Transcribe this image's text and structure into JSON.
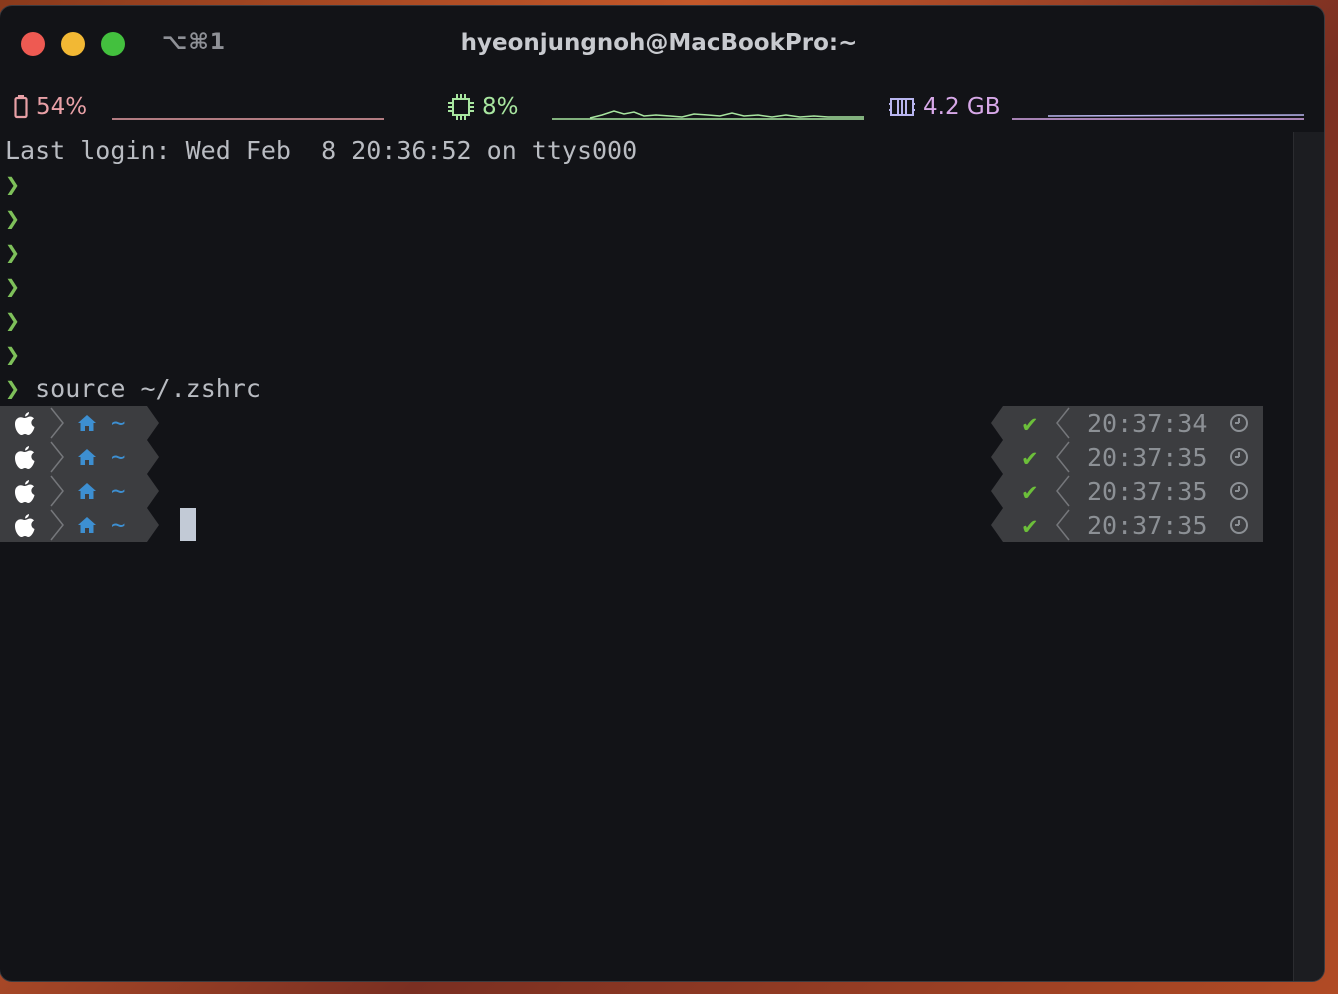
{
  "window": {
    "title": "hyeonjungnoh@MacBookPro:~",
    "shortcut": "⌥⌘1"
  },
  "status_bar": {
    "battery": "54%",
    "cpu": "8%",
    "memory": "4.2 GB"
  },
  "terminal": {
    "last_login": "Last login: Wed Feb  8 20:36:52 on ttys000",
    "prompt_char": "❯",
    "command": "source ~/.zshrc",
    "empty_prompts": 6,
    "rich_prompts": [
      {
        "path": "~",
        "status": "✔",
        "time": "20:37:34"
      },
      {
        "path": "~",
        "status": "✔",
        "time": "20:37:35"
      },
      {
        "path": "~",
        "status": "✔",
        "time": "20:37:35"
      },
      {
        "path": "~",
        "status": "✔",
        "time": "20:37:35"
      }
    ]
  },
  "icons": [
    "apple-icon",
    "home-icon",
    "check-icon",
    "clock-icon",
    "battery-icon",
    "cpu-icon",
    "memory-icon"
  ],
  "colors": {
    "background": "#121317",
    "prompt_green": "#7ec05a",
    "path_blue": "#3d8fd1",
    "battery_pink": "#e8a0a6",
    "cpu_green": "#a8e6a0",
    "memory_lavender": "#d7a8e8",
    "segment_gray": "#3c3d40"
  }
}
